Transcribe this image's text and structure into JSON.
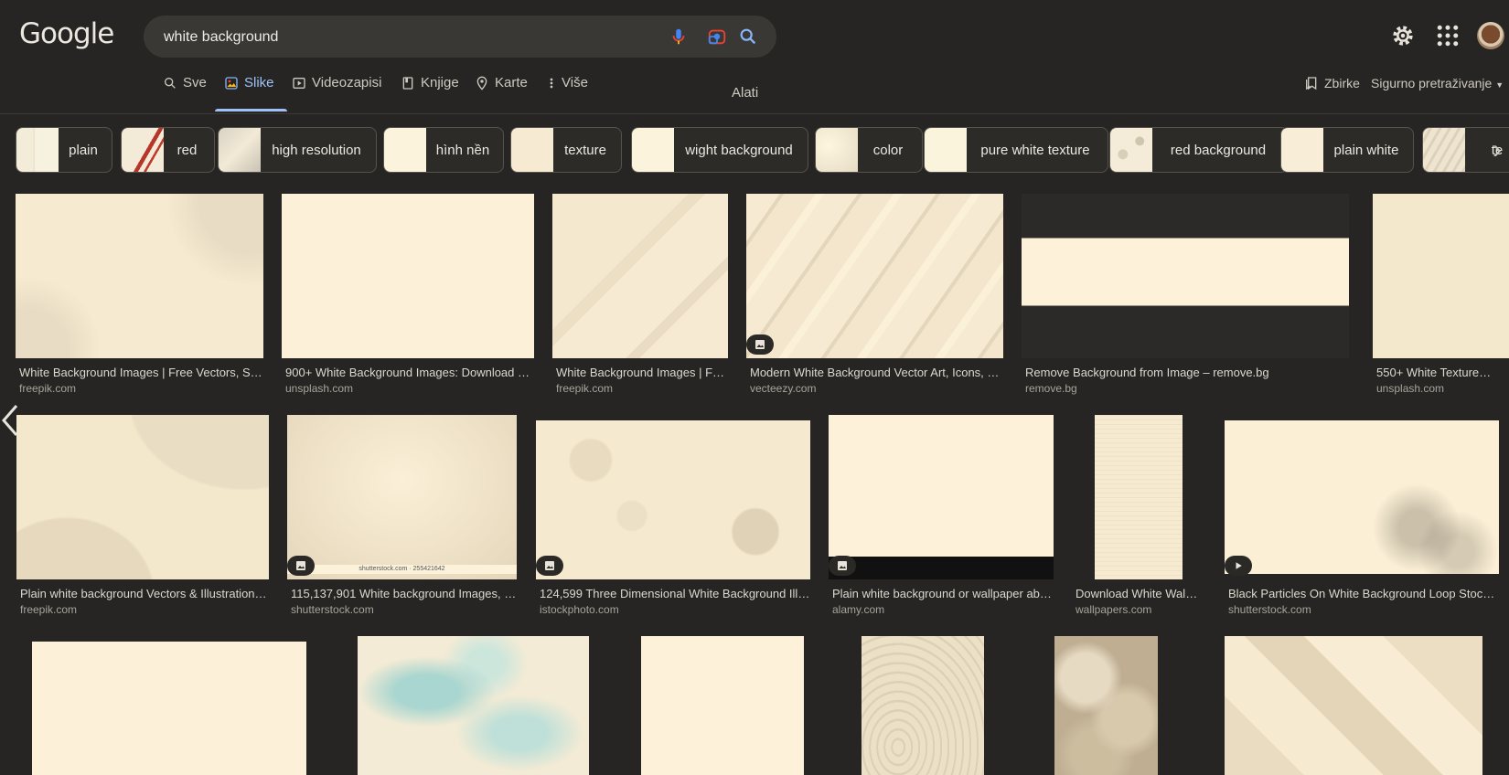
{
  "logo": "Google",
  "search": {
    "query": "white background"
  },
  "tabs": [
    {
      "label": "Sve"
    },
    {
      "label": "Slike"
    },
    {
      "label": "Videozapisi"
    },
    {
      "label": "Knjige"
    },
    {
      "label": "Karte"
    },
    {
      "label": "Više"
    }
  ],
  "tools_label": "Alati",
  "collections_label": "Zbirke",
  "safe_search_label": "Sigurno pretraživanje",
  "chips": [
    {
      "label": "plain"
    },
    {
      "label": "red"
    },
    {
      "label": "high resolution"
    },
    {
      "label": "hình nền"
    },
    {
      "label": "texture"
    },
    {
      "label": "wight background"
    },
    {
      "label": "color"
    },
    {
      "label": "pure white texture"
    },
    {
      "label": "red background"
    },
    {
      "label": "plain white"
    },
    {
      "label": "te"
    }
  ],
  "results": [
    {
      "title": "White Background Images | Free Vectors, Stoc...",
      "site": "freepik.com"
    },
    {
      "title": "900+ White Background Images: Download HD ...",
      "site": "unsplash.com"
    },
    {
      "title": "White Background Images | Fre...",
      "site": "freepik.com"
    },
    {
      "title": "Modern White Background Vector Art, Icons, an...",
      "site": "vecteezy.com"
    },
    {
      "title": "Remove Background from Image – remove.bg",
      "site": "remove.bg"
    },
    {
      "title": "550+ White Texture Pic...",
      "site": "unsplash.com"
    },
    {
      "title": "Plain white background Vectors & Illustrations ...",
      "site": "freepik.com"
    },
    {
      "title": "115,137,901 White background Images, St...",
      "site": "shutterstock.com"
    },
    {
      "title": "124,599 Three Dimensional White Background Illust...",
      "site": "istockphoto.com"
    },
    {
      "title": "Plain white background or wallpaper abst...",
      "site": "alamy.com"
    },
    {
      "title": "Download White Wallp...",
      "site": "wallpapers.com"
    },
    {
      "title": "Black Particles On White Background Loop Stock F...",
      "site": "shutterstock.com"
    }
  ],
  "image_watermark": "shutterstock.com · 255421642",
  "colors": {
    "background": "#262523",
    "accent": "#9ec1f7",
    "image_base": "#fdf0d8"
  }
}
